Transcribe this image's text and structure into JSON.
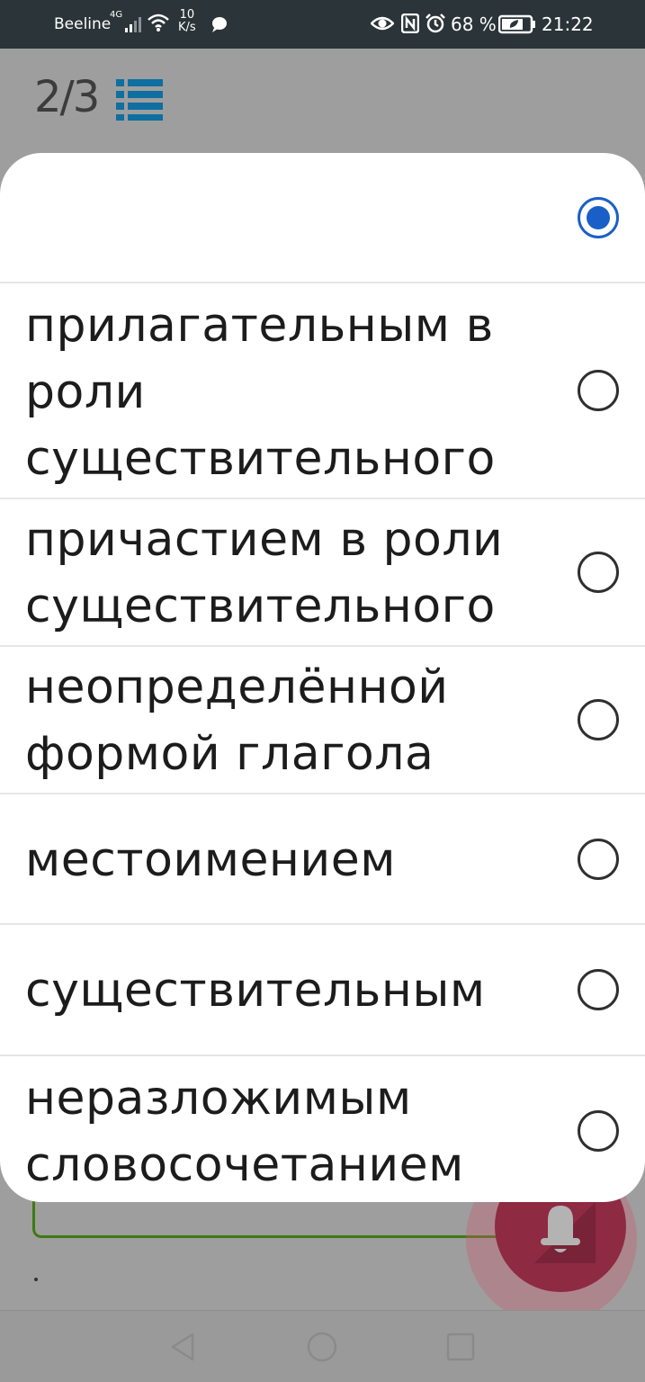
{
  "status_bar": {
    "carrier": "Beeline",
    "network": "4G",
    "speed_value": "10",
    "speed_unit": "K/s",
    "battery": "68 %",
    "time": "21:22"
  },
  "header": {
    "counter": "2/3"
  },
  "dialog": {
    "options": [
      {
        "label": "",
        "selected": true
      },
      {
        "label": "прилагательным в роли существительного",
        "selected": false
      },
      {
        "label": "причастием в роли существительного",
        "selected": false
      },
      {
        "label": "неопределённой формой глагола",
        "selected": false
      },
      {
        "label": "местоимением",
        "selected": false
      },
      {
        "label": "существительным",
        "selected": false
      },
      {
        "label": "неразложимым словосочетанием",
        "selected": false
      }
    ]
  },
  "colors": {
    "accent": "#1a5fc8",
    "list_icon": "#0f6fa0",
    "field_border": "#3f7a12",
    "fab": "#8e2a42"
  },
  "icons": {
    "fab": "bell-icon",
    "header": "list-icon"
  }
}
